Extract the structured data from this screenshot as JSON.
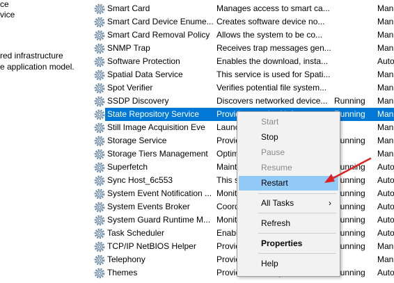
{
  "left_pane": {
    "lines": [
      "ce",
      "vice",
      "red infrastructure",
      "e application model."
    ]
  },
  "services": [
    {
      "name": "Smart Card",
      "desc": "Manages access to smart ca...",
      "status": "",
      "startup": "Man"
    },
    {
      "name": "Smart Card Device Enume...",
      "desc": "Creates software device no...",
      "status": "",
      "startup": "Man"
    },
    {
      "name": "Smart Card Removal Policy",
      "desc": "Allows the system to be co...",
      "status": "",
      "startup": "Man"
    },
    {
      "name": "SNMP Trap",
      "desc": "Receives trap messages gen...",
      "status": "",
      "startup": "Man"
    },
    {
      "name": "Software Protection",
      "desc": "Enables the download, insta...",
      "status": "",
      "startup": "Auto"
    },
    {
      "name": "Spatial Data Service",
      "desc": "This service is used for Spati...",
      "status": "",
      "startup": "Man"
    },
    {
      "name": "Spot Verifier",
      "desc": "Verifies potential file system...",
      "status": "",
      "startup": "Man"
    },
    {
      "name": "SSDP Discovery",
      "desc": "Discovers networked device...",
      "status": "Running",
      "startup": "Man"
    },
    {
      "name": "State Repository Service",
      "desc": "Provides required infrastr...",
      "status": "Running",
      "startup": "Man"
    },
    {
      "name": "Still Image Acquisition Eve",
      "desc": "Launches applications ass...",
      "status": "",
      "startup": "Man"
    },
    {
      "name": "Storage Service",
      "desc": "Provides enabling services...",
      "status": "Running",
      "startup": "Man"
    },
    {
      "name": "Storage Tiers Management",
      "desc": "Optimizes the placement o...",
      "status": "",
      "startup": "Man"
    },
    {
      "name": "Superfetch",
      "desc": "Maintains and improves sy...",
      "status": "Running",
      "startup": "Auto"
    },
    {
      "name": "Sync Host_6c553",
      "desc": "This service synchronizes...",
      "status": "Running",
      "startup": "Auto"
    },
    {
      "name": "System Event Notification ...",
      "desc": "Monitors system events an...",
      "status": "Running",
      "startup": "Auto"
    },
    {
      "name": "System Events Broker",
      "desc": "Coordinates execution of b...",
      "status": "Running",
      "startup": "Auto"
    },
    {
      "name": "System Guard Runtime M...",
      "desc": "Monitors and attests to th...",
      "status": "Running",
      "startup": "Auto"
    },
    {
      "name": "Task Scheduler",
      "desc": "Enables a user to configur...",
      "status": "Running",
      "startup": "Auto"
    },
    {
      "name": "TCP/IP NetBIOS Helper",
      "desc": "Provides support for the N...",
      "status": "Running",
      "startup": "Man"
    },
    {
      "name": "Telephony",
      "desc": "Provides Telephony API su...",
      "status": "",
      "startup": "Man"
    },
    {
      "name": "Themes",
      "desc": "Provides user experience th...",
      "status": "Running",
      "startup": "Auto"
    }
  ],
  "selected_index": 8,
  "context_menu": {
    "start": "Start",
    "stop": "Stop",
    "pause": "Pause",
    "resume": "Resume",
    "restart": "Restart",
    "all_tasks": "All Tasks",
    "refresh": "Refresh",
    "properties": "Properties",
    "help": "Help"
  },
  "colors": {
    "selection": "#0078d7",
    "menu_hover": "#91c9f7",
    "annotation_arrow": "#e02020"
  }
}
